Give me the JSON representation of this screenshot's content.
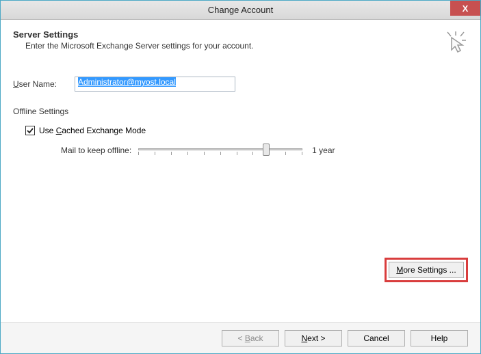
{
  "titlebar": {
    "title": "Change Account",
    "close": "X"
  },
  "header": {
    "title": "Server Settings",
    "subtitle": "Enter the Microsoft Exchange Server settings for your account."
  },
  "form": {
    "username_label_pre": "U",
    "username_label_rest": "ser Name:",
    "username_value": "Administrator@myost.local"
  },
  "offline": {
    "section_title": "Offline Settings",
    "checkbox_pre": "Use ",
    "checkbox_u": "C",
    "checkbox_rest": "ached Exchange Mode",
    "slider_label": "Mail to keep offline:",
    "slider_value": "1 year"
  },
  "buttons": {
    "more_u": "M",
    "more_rest": "ore Settings ...",
    "back_lt": "< ",
    "back_u": "B",
    "back_rest": "ack",
    "next_u": "N",
    "next_rest": "ext >",
    "cancel": "Cancel",
    "help": "Help"
  }
}
